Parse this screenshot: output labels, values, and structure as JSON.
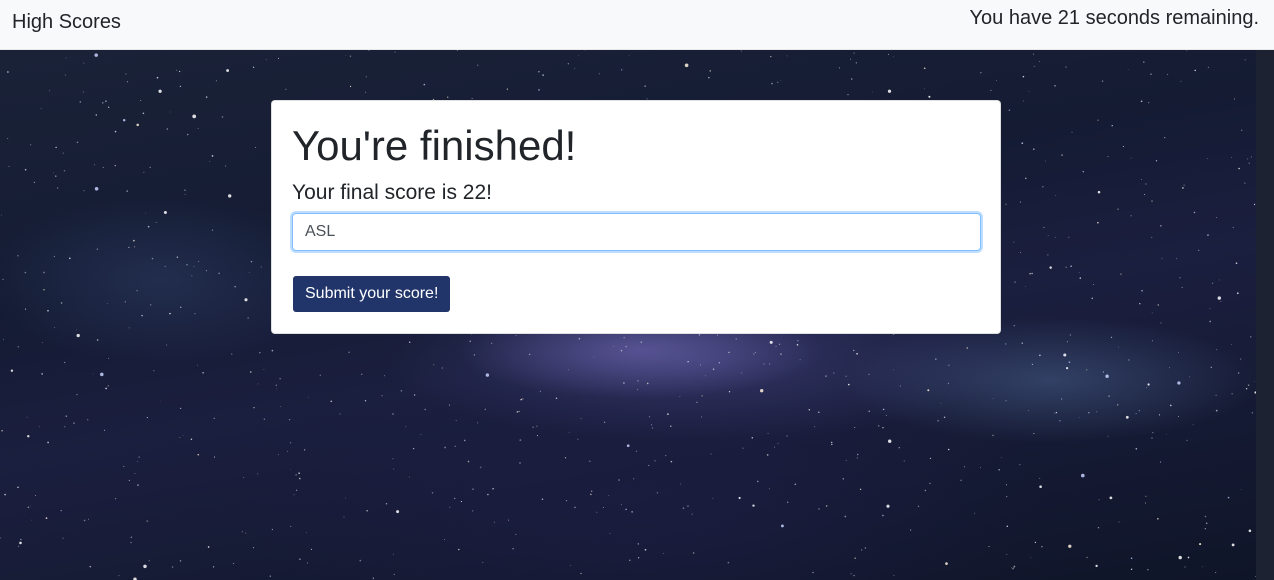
{
  "nav": {
    "high_scores_link": "High Scores",
    "timer_text": "You have 21 seconds remaining."
  },
  "card": {
    "title": "You're finished!",
    "score_text": "Your final score is 22!",
    "initials_value": "ASL",
    "submit_label": "Submit your score!"
  },
  "colors": {
    "navbar_bg": "#f8f9fa",
    "button_bg": "#22356b",
    "input_focus_border": "#80bdff"
  }
}
